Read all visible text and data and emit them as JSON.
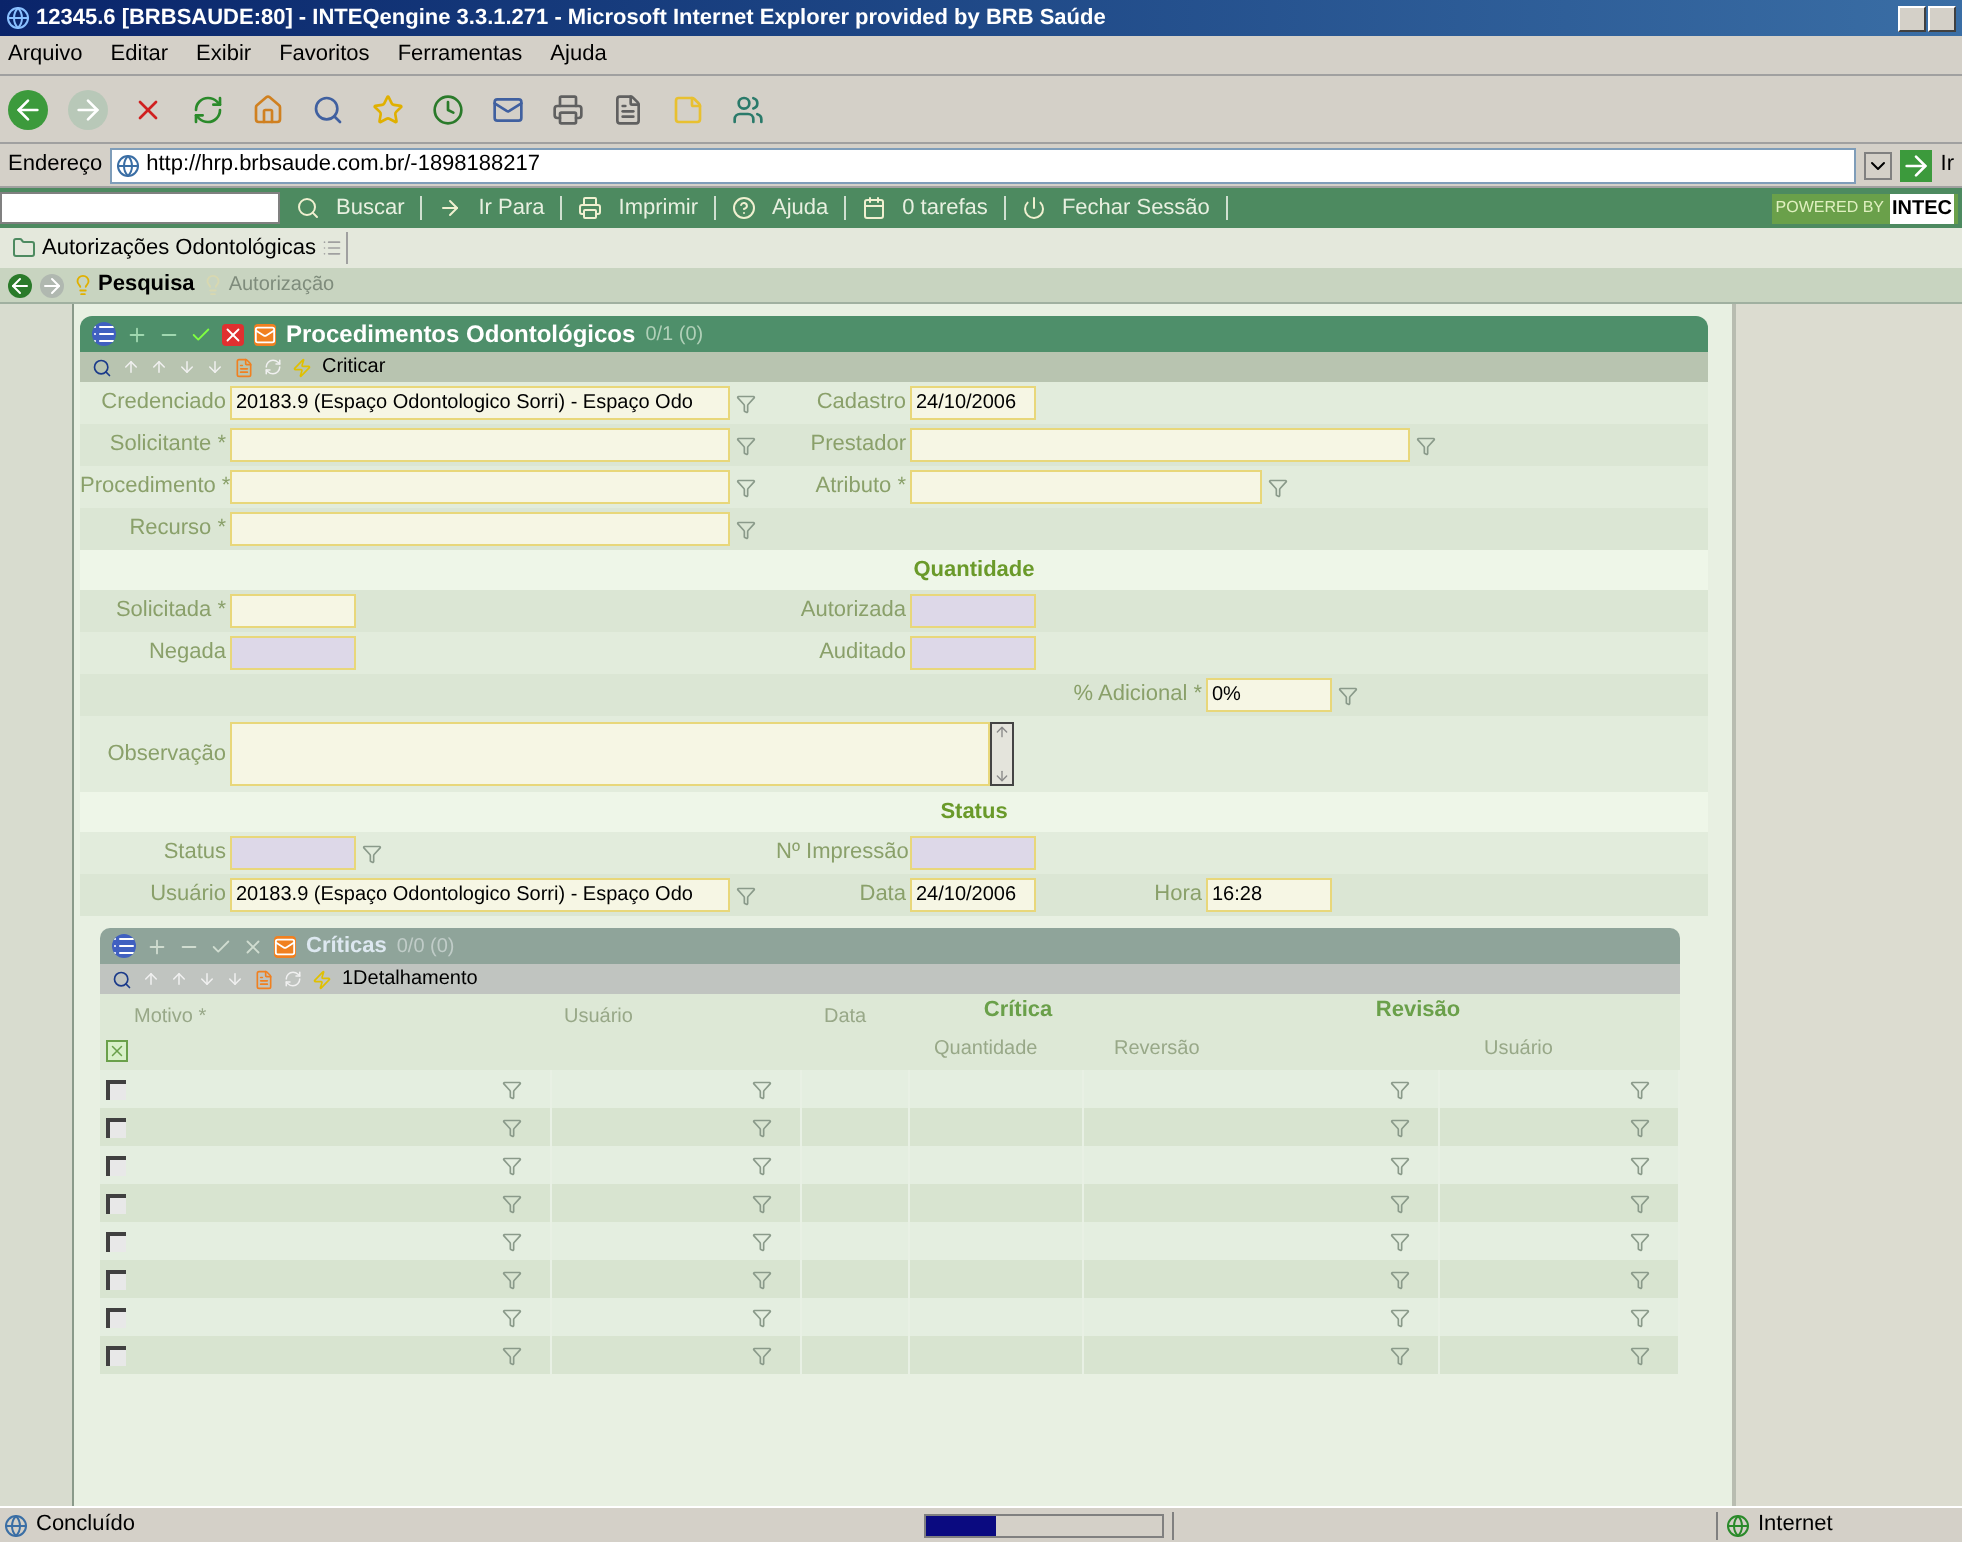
{
  "window": {
    "title": "12345.6 [BRBSAUDE:80] - INTEQengine 3.3.1.271 - Microsoft Internet Explorer provided by BRB Saúde"
  },
  "menu": [
    "Arquivo",
    "Editar",
    "Exibir",
    "Favoritos",
    "Ferramentas",
    "Ajuda"
  ],
  "address": {
    "label": "Endereço",
    "url": "http://hrp.brbsaude.com.br/-1898188217",
    "go": "Ir"
  },
  "app_toolbar": {
    "items": [
      "Buscar",
      "Ir Para",
      "Imprimir",
      "Ajuda",
      "0 tarefas",
      "Fechar Sessão"
    ],
    "powered_by": "POWERED BY",
    "brand": "INTEC"
  },
  "tab": {
    "label": "Autorizações Odontológicas"
  },
  "nav": [
    {
      "label": "Pesquisa",
      "disabled": false
    },
    {
      "label": "Autorização",
      "disabled": true
    }
  ],
  "panel": {
    "title": "Procedimentos Odontológicos",
    "count": "0/1 (0)",
    "action": "Criticar",
    "rows": [
      {
        "kind": "fields",
        "left": {
          "label": "Credenciado",
          "value": "20183.9 (Espaço Odontologico Sorri) - Espaço Odo",
          "lookup": true,
          "disabled": false
        },
        "middle": {
          "label": "Cadastro",
          "value": "24/10/2006",
          "lookup": false,
          "disabled": false
        }
      },
      {
        "kind": "fields",
        "left": {
          "label": "Solicitante *",
          "lookup": true,
          "disabled": false
        },
        "middle": {
          "label": "Prestador",
          "lookup": true,
          "disabled": false
        }
      },
      {
        "kind": "fields",
        "left": {
          "label": "Procedimento *",
          "lookup": true,
          "disabled": false
        },
        "middle": {
          "label": "Atributo *",
          "lookup": true,
          "disabled": false
        }
      },
      {
        "kind": "fields",
        "left": {
          "label": "Recurso *",
          "lookup": true,
          "disabled": false
        }
      },
      {
        "kind": "section",
        "label": "Quantidade"
      },
      {
        "kind": "fields",
        "left": {
          "label": "Solicitada *",
          "lookup": false,
          "disabled": false
        },
        "middle": {
          "label": "Autorizada",
          "lookup": false,
          "disabled": true
        }
      },
      {
        "kind": "fields",
        "left": {
          "label": "Negada",
          "lookup": false,
          "disabled": true
        },
        "middle": {
          "label": "Auditado",
          "lookup": false,
          "disabled": true
        }
      },
      {
        "kind": "fields",
        "right": {
          "label": "% Adicional *",
          "value": "0%",
          "lookup": true,
          "disabled": false
        }
      },
      {
        "kind": "textarea",
        "left": {
          "label": "Observação",
          "disabled": false
        }
      },
      {
        "kind": "section",
        "label": "Status"
      },
      {
        "kind": "fields",
        "left": {
          "label": "Status",
          "lookup": true,
          "disabled": true
        },
        "middle": {
          "label": "Nº Impressão",
          "lookup": false,
          "disabled": true
        }
      },
      {
        "kind": "fields",
        "left": {
          "label": "Usuário",
          "value": "20183.9 (Espaço Odontologico Sorri) - Espaço Odo",
          "lookup": true,
          "disabled": false
        },
        "middle": {
          "label": "Data",
          "value": "24/10/2006",
          "lookup": false,
          "disabled": false
        },
        "right": {
          "label": "Hora",
          "value": "16:28",
          "lookup": false,
          "disabled": false
        }
      }
    ]
  },
  "subpanel": {
    "title": "Críticas",
    "count": "0/0 (0)",
    "action": "1Detalhamento",
    "all_checked": true,
    "groups": [
      "Crítica",
      "Revisão"
    ],
    "columns": [
      "Motivo *",
      "Usuário",
      "Data",
      "Quantidade",
      "Reversão",
      "Usuário"
    ],
    "rows": [
      {
        "checked": false
      },
      {
        "checked": false
      },
      {
        "checked": false
      },
      {
        "checked": false
      },
      {
        "checked": false
      },
      {
        "checked": false
      },
      {
        "checked": false
      },
      {
        "checked": false
      }
    ]
  },
  "status_bar": {
    "text": "Concluído",
    "zone": "Internet",
    "level": 0.3
  }
}
